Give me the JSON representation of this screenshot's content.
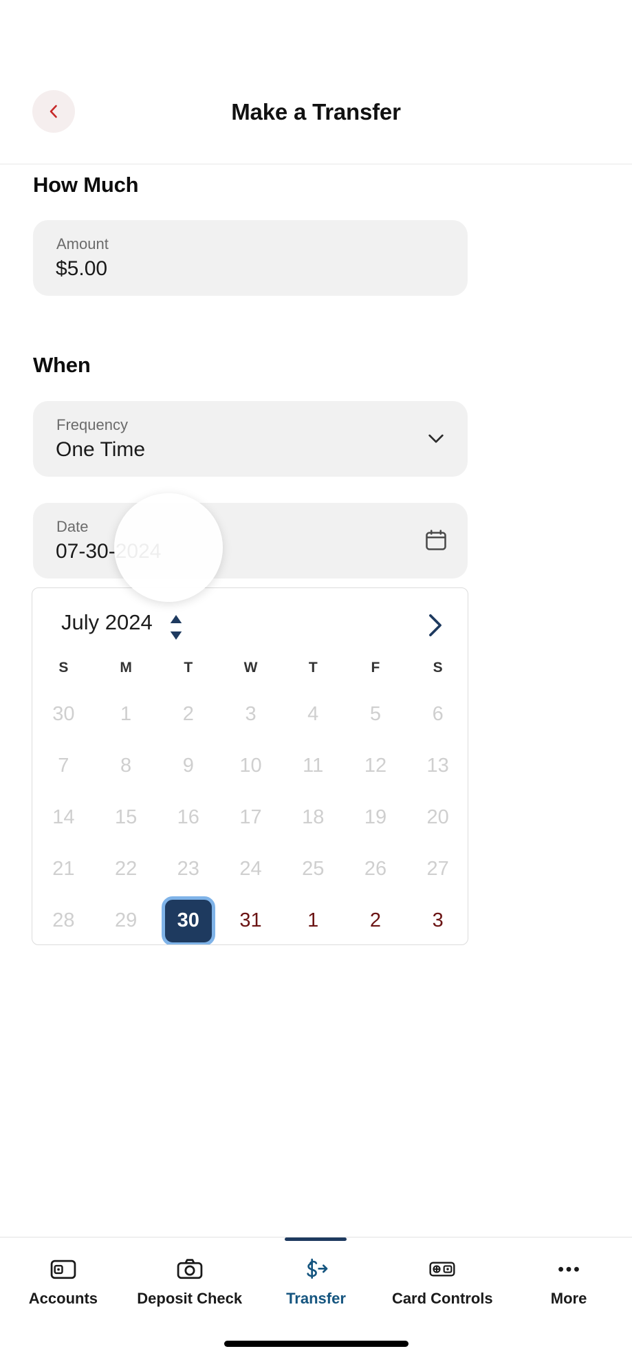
{
  "header": {
    "title": "Make a Transfer",
    "back_icon": "chevron-left-icon"
  },
  "sections": {
    "how_much": {
      "title": "How Much",
      "amount": {
        "label": "Amount",
        "value": "$5.00"
      }
    },
    "when": {
      "title": "When",
      "frequency": {
        "label": "Frequency",
        "value": "One Time",
        "icon": "chevron-down-icon"
      },
      "date": {
        "label": "Date",
        "value": "07-30-2024",
        "icon": "calendar-icon"
      }
    }
  },
  "calendar": {
    "month_label": "July 2024",
    "spinner_icon": "up-down-spinner-icon",
    "next_icon": "chevron-right-icon",
    "day_headers": [
      "S",
      "M",
      "T",
      "W",
      "T",
      "F",
      "S"
    ],
    "selected_day": "30",
    "weeks": [
      [
        {
          "day": "30",
          "state": "disabled"
        },
        {
          "day": "1",
          "state": "disabled"
        },
        {
          "day": "2",
          "state": "disabled"
        },
        {
          "day": "3",
          "state": "disabled"
        },
        {
          "day": "4",
          "state": "disabled"
        },
        {
          "day": "5",
          "state": "disabled"
        },
        {
          "day": "6",
          "state": "disabled"
        }
      ],
      [
        {
          "day": "7",
          "state": "disabled"
        },
        {
          "day": "8",
          "state": "disabled"
        },
        {
          "day": "9",
          "state": "disabled"
        },
        {
          "day": "10",
          "state": "disabled"
        },
        {
          "day": "11",
          "state": "disabled"
        },
        {
          "day": "12",
          "state": "disabled"
        },
        {
          "day": "13",
          "state": "disabled"
        }
      ],
      [
        {
          "day": "14",
          "state": "disabled"
        },
        {
          "day": "15",
          "state": "disabled"
        },
        {
          "day": "16",
          "state": "disabled"
        },
        {
          "day": "17",
          "state": "disabled"
        },
        {
          "day": "18",
          "state": "disabled"
        },
        {
          "day": "19",
          "state": "disabled"
        },
        {
          "day": "20",
          "state": "disabled"
        }
      ],
      [
        {
          "day": "21",
          "state": "disabled"
        },
        {
          "day": "22",
          "state": "disabled"
        },
        {
          "day": "23",
          "state": "disabled"
        },
        {
          "day": "24",
          "state": "disabled"
        },
        {
          "day": "25",
          "state": "disabled"
        },
        {
          "day": "26",
          "state": "disabled"
        },
        {
          "day": "27",
          "state": "disabled"
        }
      ],
      [
        {
          "day": "28",
          "state": "disabled"
        },
        {
          "day": "29",
          "state": "disabled"
        },
        {
          "day": "30",
          "state": "selected"
        },
        {
          "day": "31",
          "state": "enabled"
        },
        {
          "day": "1",
          "state": "enabled"
        },
        {
          "day": "2",
          "state": "enabled"
        },
        {
          "day": "3",
          "state": "enabled"
        }
      ]
    ]
  },
  "bottom_nav": {
    "items": [
      {
        "label": "Accounts",
        "icon": "wallet-icon",
        "active": false
      },
      {
        "label": "Deposit Check",
        "icon": "camera-icon",
        "active": false
      },
      {
        "label": "Transfer",
        "icon": "dollar-arrow-icon",
        "active": true
      },
      {
        "label": "Card Controls",
        "icon": "card-plus-icon",
        "active": false
      },
      {
        "label": "More",
        "icon": "ellipsis-icon",
        "active": false
      }
    ]
  },
  "colors": {
    "accent_red": "#c62828",
    "selected_navy": "#1e3a5f",
    "focus_ring_blue": "#7fb3e8",
    "enabled_date": "#6b1414",
    "field_bg": "#f1f1f1"
  }
}
